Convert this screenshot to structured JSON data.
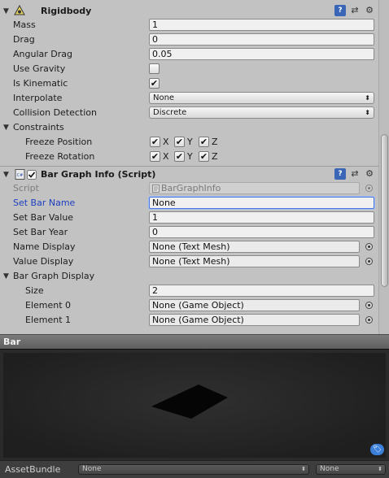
{
  "rigidbody": {
    "title": "Rigidbody",
    "fields": {
      "mass_label": "Mass",
      "mass_value": "1",
      "drag_label": "Drag",
      "drag_value": "0",
      "angular_drag_label": "Angular Drag",
      "angular_drag_value": "0.05",
      "use_gravity_label": "Use Gravity",
      "use_gravity_checked": false,
      "is_kinematic_label": "Is Kinematic",
      "is_kinematic_checked": true,
      "interpolate_label": "Interpolate",
      "interpolate_value": "None",
      "collision_detection_label": "Collision Detection",
      "collision_detection_value": "Discrete"
    },
    "constraints": {
      "label": "Constraints",
      "freeze_position_label": "Freeze Position",
      "freeze_rotation_label": "Freeze Rotation",
      "axes": [
        "X",
        "Y",
        "Z"
      ]
    }
  },
  "script_component": {
    "title": "Bar Graph Info (Script)",
    "script_label": "Script",
    "script_value": "BarGraphInfo",
    "set_bar_name_label": "Set Bar Name",
    "set_bar_name_value": "None",
    "set_bar_value_label": "Set Bar Value",
    "set_bar_value_value": "1",
    "set_bar_year_label": "Set Bar Year",
    "set_bar_year_value": "0",
    "name_display_label": "Name Display",
    "name_display_value": "None (Text Mesh)",
    "value_display_label": "Value Display",
    "value_display_value": "None (Text Mesh)",
    "bar_graph_display_label": "Bar Graph Display",
    "size_label": "Size",
    "size_value": "2",
    "element0_label": "Element 0",
    "element0_value": "None (Game Object)",
    "element1_label": "Element 1",
    "element1_value": "None (Game Object)"
  },
  "preview": {
    "title": "Bar"
  },
  "asset_bundle": {
    "label": "AssetBundle",
    "name_value": "None",
    "variant_value": "None"
  },
  "colors": {
    "inspector_bg": "#c2c2c2",
    "focus_blue": "#4a74d9",
    "preview_bg": "#2a2a2a",
    "active_label": "#1f3fbf"
  }
}
